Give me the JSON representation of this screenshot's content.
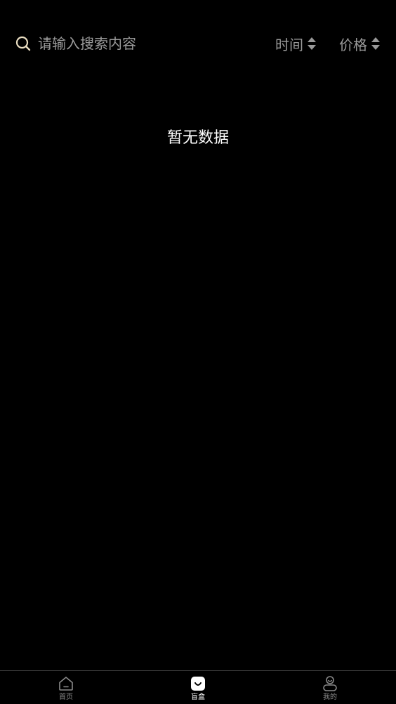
{
  "search": {
    "placeholder": "请输入搜索内容",
    "value": "",
    "icon": "search-icon"
  },
  "sort": {
    "time_label": "时间",
    "price_label": "价格",
    "icon": "sort-arrows-icon"
  },
  "empty_state": {
    "message": "暂无数据"
  },
  "tabbar": {
    "active_index": 1,
    "items": [
      {
        "label": "首页",
        "icon": "home-icon"
      },
      {
        "label": "盲盒",
        "icon": "blind-box-icon"
      },
      {
        "label": "我的",
        "icon": "profile-icon"
      }
    ]
  },
  "colors": {
    "background": "#000000",
    "search_icon": "#e8dcc0",
    "muted_text": "#9a9a9a",
    "primary_text": "#ffffff"
  }
}
